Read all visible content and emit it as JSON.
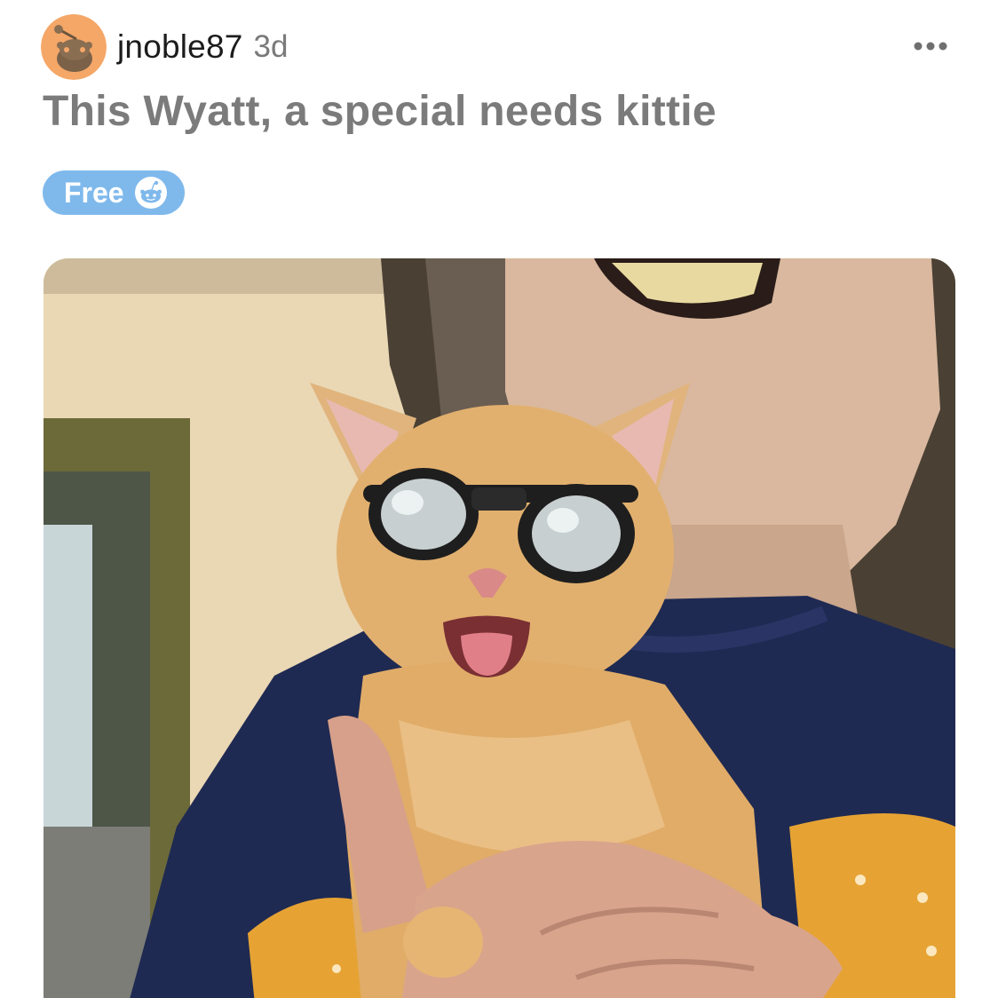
{
  "post": {
    "username": "jnoble87",
    "age": "3d",
    "title": "This Wyatt, a special needs kittie",
    "flair": {
      "label": "Free",
      "icon": "reddit-snoo-icon",
      "color": "#7fb9ec"
    },
    "avatar_icon": "snoo-avatar-icon",
    "more_icon": "ellipsis-icon",
    "image_icon": "kitten-photo"
  },
  "colors": {
    "avatar_bg": "#f5a768",
    "title_text": "#7b7b7b",
    "meta_text": "#7a7a7a"
  }
}
